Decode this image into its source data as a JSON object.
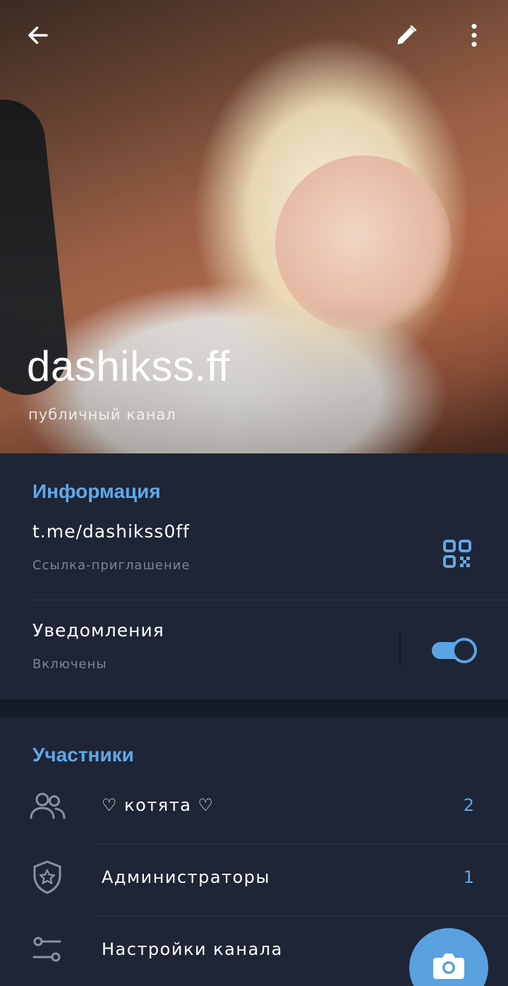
{
  "header": {
    "channel_name": "dashikss.ff",
    "channel_type": "публичный канал",
    "icons": {
      "back": "arrow-left-icon",
      "edit": "pencil-icon",
      "more": "more-vertical-icon"
    }
  },
  "info": {
    "title": "Информация",
    "link": {
      "value": "t.me/dashikss0ff",
      "caption": "Ссылка-приглашение",
      "icon": "qr-code-icon"
    },
    "notifications": {
      "label": "Уведомления",
      "status": "Включены",
      "enabled": true
    }
  },
  "members": {
    "title": "Участники",
    "items": [
      {
        "label": "♡ котята ♡",
        "count": "2",
        "icon": "people-icon"
      },
      {
        "label": "Администраторы",
        "count": "1",
        "icon": "shield-star-icon"
      },
      {
        "label": "Настройки канала",
        "count": "",
        "icon": "sliders-icon"
      }
    ]
  },
  "fab": {
    "icon": "camera-icon"
  },
  "colors": {
    "accent": "#5fa8e8",
    "background": "#1e2536",
    "secondary_text": "#7c8597"
  }
}
